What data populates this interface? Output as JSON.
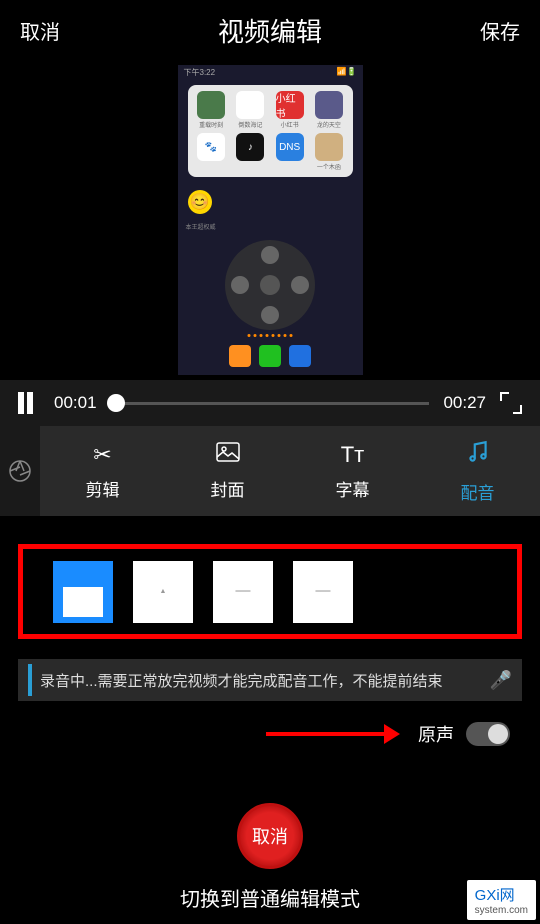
{
  "header": {
    "cancel": "取消",
    "title": "视频编辑",
    "save": "保存"
  },
  "preview": {
    "status_time": "下午3:22",
    "apps": [
      {
        "color": "#4a7a4a",
        "label": "重载时刻"
      },
      {
        "color": "#fff",
        "label": "倒数海记",
        "text": "🎙"
      },
      {
        "color": "#e03030",
        "label": "小红书",
        "text": "小红书"
      },
      {
        "color": "#5a5a8a",
        "label": "龙的天空"
      },
      {
        "color": "#fff",
        "label": "",
        "text": "🐾"
      },
      {
        "color": "#111",
        "label": "",
        "text": "♪"
      },
      {
        "color": "#2a80e0",
        "label": "",
        "text": "DNS"
      },
      {
        "color": "#d0b080",
        "label": "一个木函"
      }
    ],
    "emoji_label": "本王超权威"
  },
  "playback": {
    "current": "00:01",
    "total": "00:27"
  },
  "toolbar": {
    "items": [
      {
        "icon": "✂",
        "label": "剪辑"
      },
      {
        "icon": "🖼",
        "label": "封面"
      },
      {
        "icon": "Tᴛ",
        "label": "字幕"
      },
      {
        "icon": "♫",
        "label": "配音",
        "active": true
      }
    ]
  },
  "recording": {
    "text": "录音中...需要正常放完视频才能完成配音工作，不能提前结束"
  },
  "original_sound": {
    "label": "原声"
  },
  "cancel_record_btn": "取消",
  "switch_mode": "切换到普通编辑模式",
  "watermark": {
    "main": "GXi网",
    "sub": "system.com"
  }
}
